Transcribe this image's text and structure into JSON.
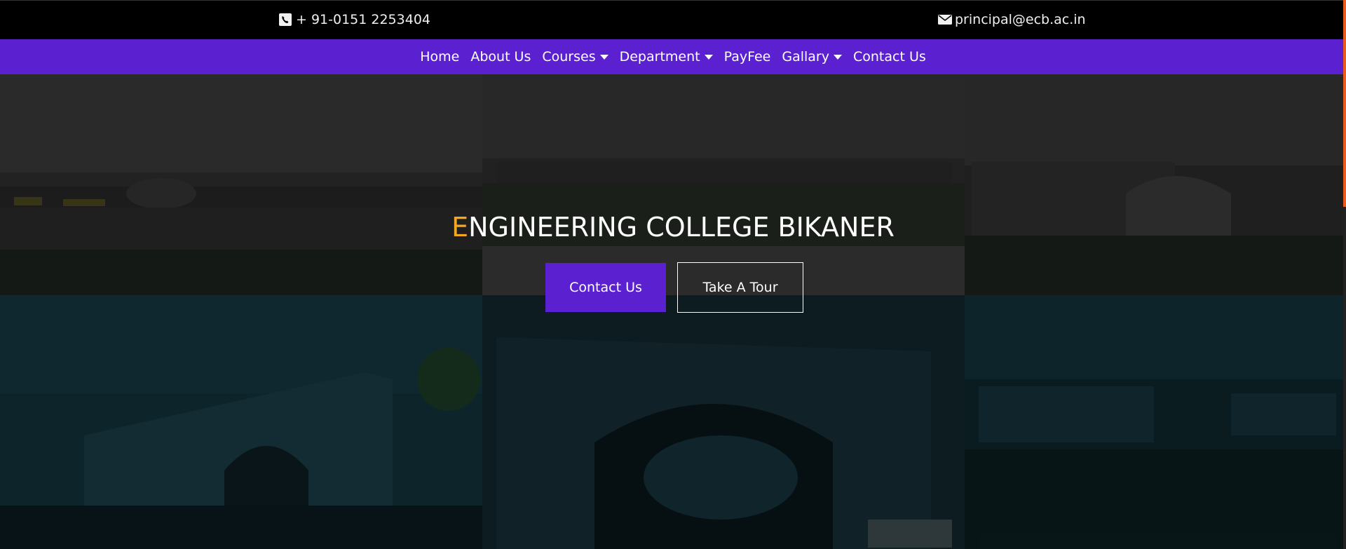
{
  "topbar": {
    "phone": "+ 91-0151 2253404",
    "email": "principal@ecb.ac.in",
    "phone_icon": "phone-icon",
    "email_icon": "envelope-icon"
  },
  "nav": {
    "items": [
      {
        "label": "Home",
        "dropdown": false
      },
      {
        "label": "About Us",
        "dropdown": false
      },
      {
        "label": "Courses",
        "dropdown": true
      },
      {
        "label": "Department",
        "dropdown": true
      },
      {
        "label": "PayFee",
        "dropdown": false
      },
      {
        "label": "Gallary",
        "dropdown": true
      },
      {
        "label": "Contact Us",
        "dropdown": false
      }
    ]
  },
  "hero": {
    "title_first_letter": "E",
    "title_rest": "NGINEERING COLLEGE BIKANER",
    "primary_button": "Contact Us",
    "secondary_button": "Take A Tour"
  },
  "colors": {
    "nav_bg": "#5b21d0",
    "accent": "#f5a623",
    "topbar_bg": "#000000",
    "scroll_accent": "#e85d1f"
  }
}
